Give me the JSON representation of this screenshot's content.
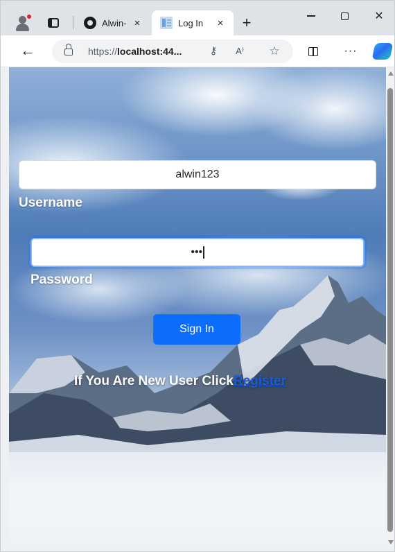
{
  "browser": {
    "tabs": [
      {
        "title": "Alwin-",
        "icon": "github-icon"
      },
      {
        "title": "Log In",
        "icon": "page-icon",
        "active": true
      }
    ],
    "tab_close_glyph": "×",
    "new_tab_glyph": "+",
    "window_close_glyph": "✕",
    "back_glyph": "←",
    "address": {
      "scheme": "https://",
      "host": "localhost:44...",
      "key_glyph": "⚷",
      "read_aloud_glyph": "A⁾",
      "favorite_glyph": "☆"
    },
    "more_glyph": "···"
  },
  "login": {
    "username_value": "alwin123",
    "username_label": "Username",
    "password_value": "•••",
    "password_label": "Password",
    "sign_in_label": "Sign In",
    "new_user_text": "If You Are New User Click",
    "register_link": "Register"
  },
  "colors": {
    "primary": "#0d6efd",
    "link": "#1a5cd8",
    "label_text": "#ffffff"
  }
}
